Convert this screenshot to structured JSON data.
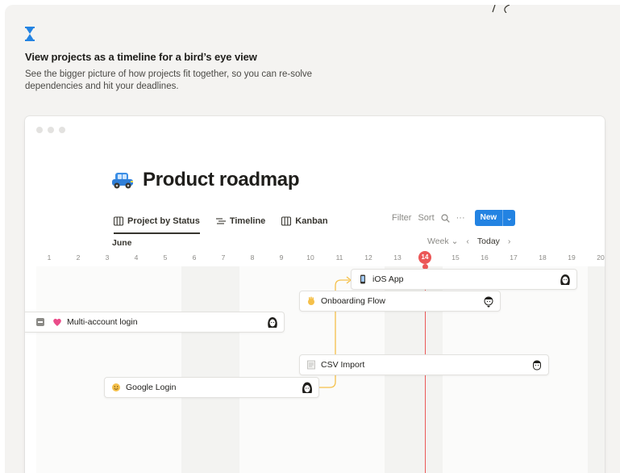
{
  "hero": {
    "icon": "hourglass-icon",
    "headline": "View projects as a timeline for a bird’s eye view",
    "subtext": "See the bigger picture of how projects fit together, so you can re-solve dependencies and hit your deadlines."
  },
  "window": {
    "controls": [
      "close",
      "minimize",
      "maximize"
    ]
  },
  "page": {
    "icon": "car-icon",
    "title": "Product roadmap"
  },
  "views": [
    {
      "label": "Project by Status",
      "icon": "table-icon",
      "active": true
    },
    {
      "label": "Timeline",
      "icon": "timeline-icon",
      "active": false
    },
    {
      "label": "Kanban",
      "icon": "board-icon",
      "active": false
    }
  ],
  "toolbar": {
    "filter": "Filter",
    "sort": "Sort",
    "search_icon": "search-icon",
    "more": "···",
    "new": "New",
    "new_caret": "⌄"
  },
  "timeline": {
    "month": "June",
    "scale": "Week",
    "scale_caret": "⌄",
    "prev": "‹",
    "today_label": "Today",
    "next": "›",
    "days": [
      "1",
      "2",
      "3",
      "4",
      "5",
      "6",
      "7",
      "8",
      "9",
      "10",
      "11",
      "12",
      "13",
      "14",
      "15",
      "16",
      "17",
      "18",
      "19",
      "20"
    ],
    "today": "14",
    "today_color": "#eb5757",
    "accent": "#2383e2",
    "dependency_color": "#f5c04a"
  },
  "projects": [
    {
      "name": "iOS App",
      "emoji": "phone-icon"
    },
    {
      "name": "Onboarding Flow",
      "emoji": "waving-hand-icon"
    },
    {
      "name": "Multi-account login",
      "emoji": "heart-icon"
    },
    {
      "name": "CSV Import",
      "emoji": "page-icon"
    },
    {
      "name": "Google Login",
      "emoji": "smile-icon"
    }
  ]
}
